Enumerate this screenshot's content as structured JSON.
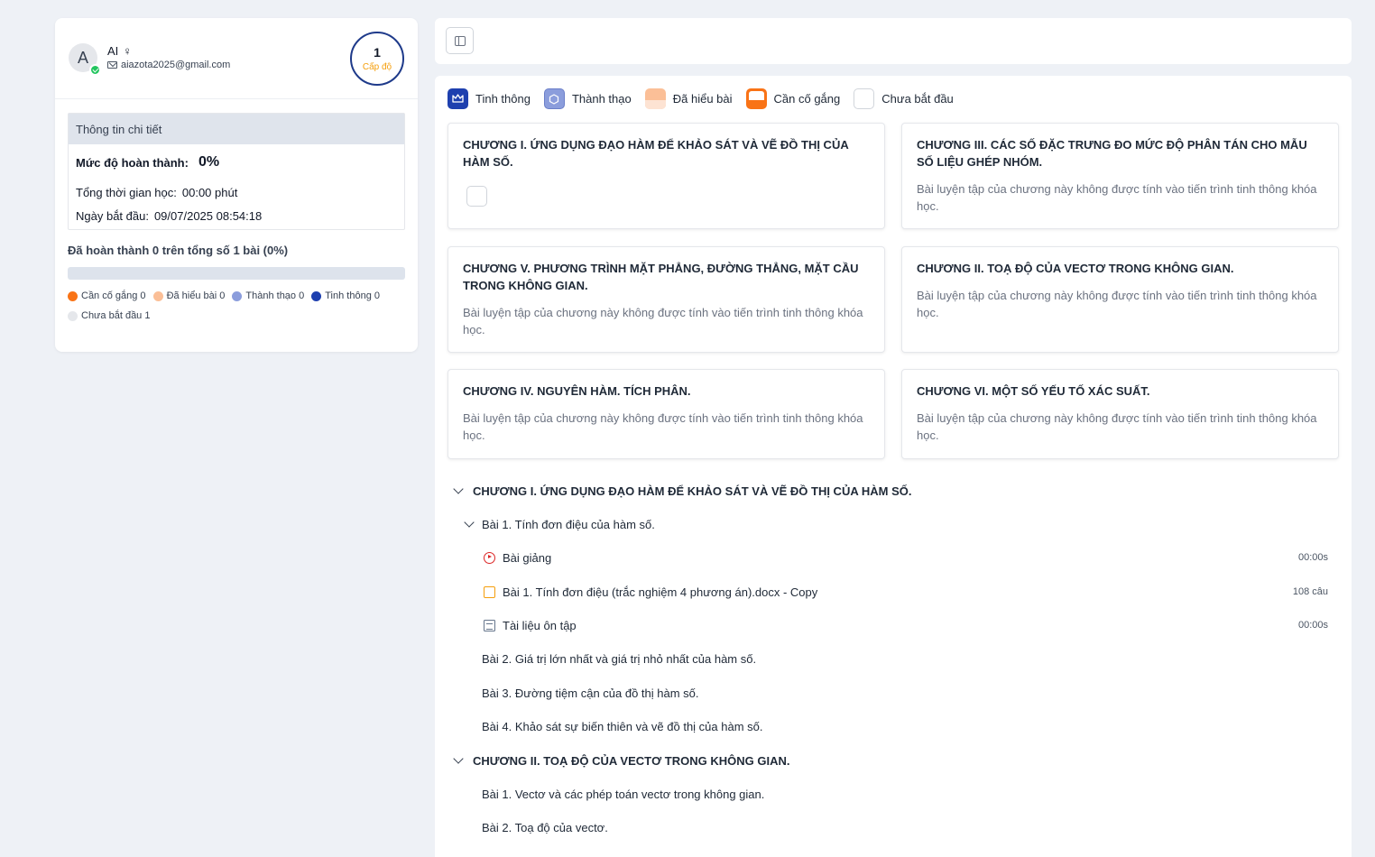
{
  "profile": {
    "avatar_letter": "A",
    "name": "AI",
    "gender_symbol": "♀",
    "email": "aiazota2025@gmail.com",
    "level_number": "1",
    "level_label": "Cấp độ"
  },
  "details": {
    "header": "Thông tin chi tiết",
    "completion_label": "Mức độ hoàn thành:",
    "completion_value": "0%",
    "study_time_label": "Tổng thời gian học:",
    "study_time_value": "00:00 phút",
    "start_date_label": "Ngày bắt đầu:",
    "start_date_value": "09/07/2025 08:54:18"
  },
  "progress": {
    "summary": "Đã hoàn thành 0 trên tổng số 1 bài (0%)",
    "fraction": 0
  },
  "stats_legend": [
    {
      "label": "Cần cố gắng 0",
      "color": "#f97316"
    },
    {
      "label": "Đã hiểu bài 0",
      "color": "#fbbf97"
    },
    {
      "label": "Thành thạo 0",
      "color": "#8b9ddc"
    },
    {
      "label": "Tinh thông 0",
      "color": "#1e40af"
    },
    {
      "label": "Chưa bắt đầu 1",
      "color": "#e5e7eb"
    }
  ],
  "status_legend": {
    "mastery": "Tinh thông",
    "fluent": "Thành thạo",
    "understood": "Đã hiểu bài",
    "effort": "Cần cố gắng",
    "not_started": "Chưa bắt đầu"
  },
  "chapter_cards": [
    {
      "title": "CHƯƠNG I. ỨNG DỤNG ĐẠO HÀM ĐỂ KHẢO SÁT VÀ VẼ ĐỒ THỊ CỦA HÀM SỐ.",
      "note": ""
    },
    {
      "title": "CHƯƠNG III. CÁC SỐ ĐẶC TRƯNG ĐO MỨC ĐỘ PHÂN TÁN CHO MẪU SỐ LIỆU GHÉP NHÓM.",
      "note": "Bài luyện tập của chương này không được tính vào tiến trình tinh thông khóa học."
    },
    {
      "title": "CHƯƠNG V. PHƯƠNG TRÌNH MẶT PHẲNG, ĐƯỜNG THẲNG, MẶT CẦU TRONG KHÔNG GIAN.",
      "note": "Bài luyện tập của chương này không được tính vào tiến trình tinh thông khóa học."
    },
    {
      "title": "CHƯƠNG II. TOẠ ĐỘ CỦA VECTƠ TRONG KHÔNG GIAN.",
      "note": "Bài luyện tập của chương này không được tính vào tiến trình tinh thông khóa học."
    },
    {
      "title": "CHƯƠNG IV. NGUYÊN HÀM. TÍCH PHÂN.",
      "note": "Bài luyện tập của chương này không được tính vào tiến trình tinh thông khóa học."
    },
    {
      "title": "CHƯƠNG VI. MỘT SỐ YẾU TỐ XÁC SUẤT.",
      "note": "Bài luyện tập của chương này không được tính vào tiến trình tinh thông khóa học."
    }
  ],
  "tree": {
    "chapter1": {
      "title": "CHƯƠNG I. ỨNG DỤNG ĐẠO HÀM ĐỂ KHẢO SÁT VÀ VẼ ĐỒ THỊ CỦA HÀM SỐ.",
      "lesson1": {
        "title": "Bài 1. Tính đơn điệu của hàm số.",
        "items": [
          {
            "label": "Bài giảng",
            "meta": "00:00s",
            "icon": "play-icon"
          },
          {
            "label": "Bài 1. Tính đơn điệu (trắc nghiệm 4 phương án).docx - Copy",
            "meta": "108 câu",
            "icon": "quiz-icon"
          },
          {
            "label": "Tài liệu ôn tập",
            "meta": "00:00s",
            "icon": "document-icon"
          }
        ]
      },
      "lessons": [
        "Bài 2. Giá trị lớn nhất và giá trị nhỏ nhất của hàm số.",
        "Bài 3. Đường tiệm cận của đồ thị hàm số.",
        "Bài 4. Khảo sát sự biến thiên và vẽ đồ thị của hàm số."
      ]
    },
    "chapter2": {
      "title": "CHƯƠNG II. TOẠ ĐỘ CỦA VECTƠ TRONG KHÔNG GIAN.",
      "lessons": [
        "Bài 1. Vectơ và các phép toán vectơ trong không gian.",
        "Bài 2. Toạ độ của vectơ."
      ]
    }
  }
}
